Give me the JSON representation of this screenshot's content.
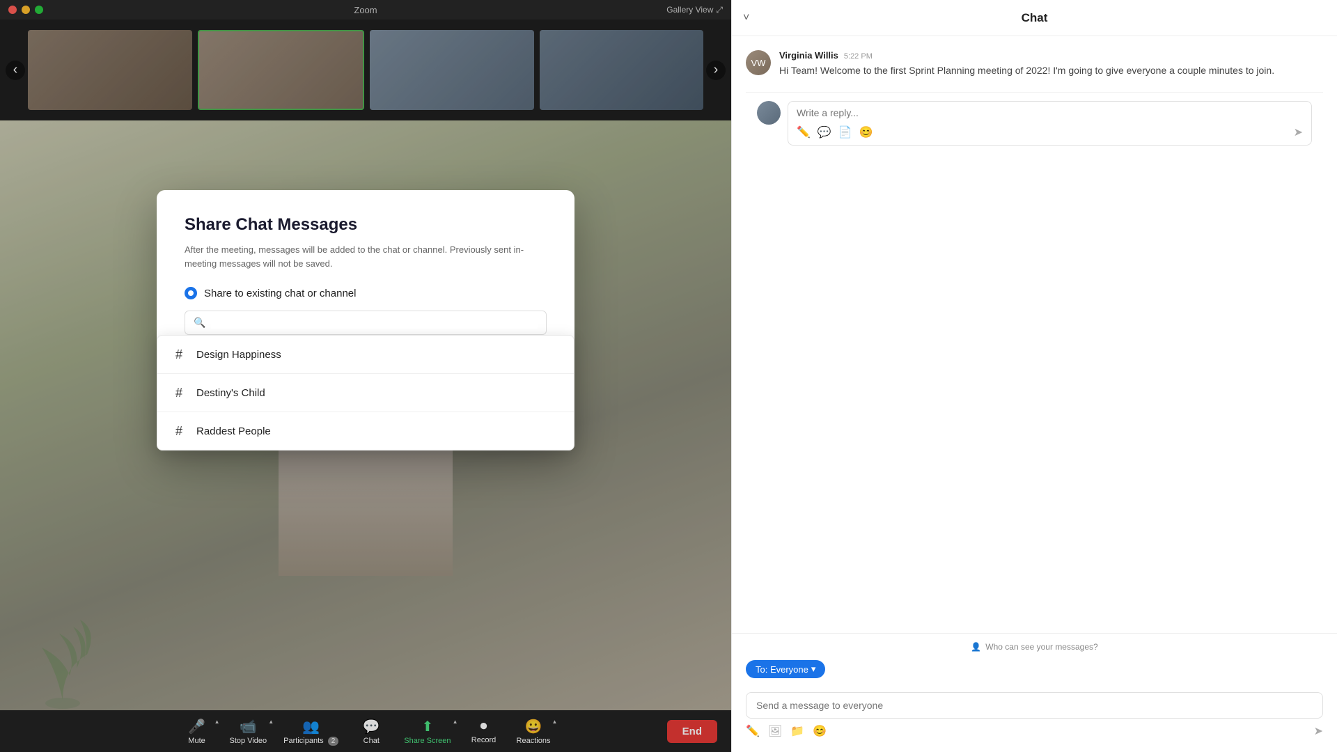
{
  "titleBar": {
    "title": "Zoom",
    "galleryView": "Gallery View"
  },
  "toolbar": {
    "mute": "Mute",
    "stopVideo": "Stop Video",
    "participants": "Participants",
    "participantsCount": "2",
    "chat": "Chat",
    "shareScreen": "Share Screen",
    "record": "Record",
    "reactions": "Reactions",
    "end": "End"
  },
  "modal": {
    "title": "Share Chat Messages",
    "description": "After the meeting, messages will be added to the chat or channel. Previously sent in-meeting messages will not be saved.",
    "radioOption": "Share to existing chat or channel",
    "searchPlaceholder": "",
    "channels": [
      {
        "id": "design-happiness",
        "name": "Design Happiness"
      },
      {
        "id": "destinys-child",
        "name": "Destiny's Child"
      },
      {
        "id": "raddest-people",
        "name": "Raddest People"
      }
    ]
  },
  "chat": {
    "title": "Chat",
    "message": {
      "sender": "Virginia Willis",
      "time": "5:22 PM",
      "text": "Hi Team! Welcome to the first Sprint Planning meeting of 2022! I'm going to give everyone a couple minutes to join."
    },
    "replyPlaceholder": "Write a reply...",
    "whoCanSee": "Who can see your messages?",
    "toEveryone": "To: Everyone",
    "sendPlaceholder": "Send a message to everyone"
  }
}
